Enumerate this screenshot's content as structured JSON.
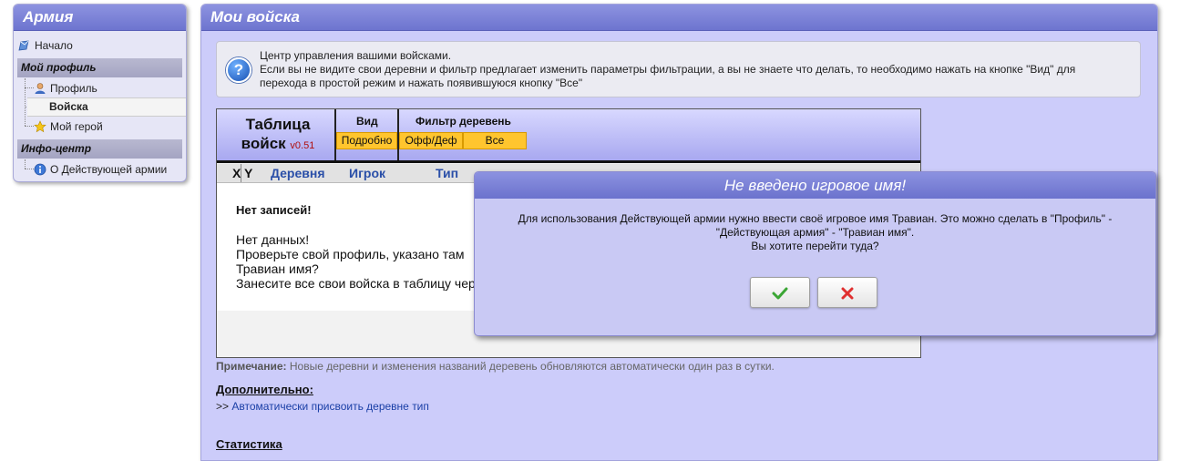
{
  "sidebar": {
    "title": "Армия",
    "items": {
      "home": "Начало",
      "profile_section": "Мой профиль",
      "profile": "Профиль",
      "troops": "Войска",
      "hero": "Мой герой",
      "info_section": "Инфо-центр",
      "about": "О Действующей армии"
    }
  },
  "main": {
    "title": "Мои войска",
    "info": {
      "line1": "Центр управления вашими войсками.",
      "line2": "Если вы не видите свои деревни и фильтр предлагает изменить параметры фильтрации, а вы не знаете что делать, то необходимо нажать на кнопке \"Вид\" для перехода в простой режим и нажать появившуюся кнопку \"Все\""
    },
    "table": {
      "title_line1": "Таблица",
      "title_line2": "войск",
      "version": "v0.51",
      "view_label": "Вид",
      "view_option": "Подробно",
      "filter_label": "Фильтр деревень",
      "filter_options": [
        "Офф/Деф",
        "Все"
      ],
      "columns": {
        "x": "X",
        "y": "Y",
        "village": "Деревня",
        "player": "Игрок",
        "type": "Тип"
      },
      "empty_title": "Нет записей!",
      "empty_lines": [
        "Нет данных!",
        "Проверьте свой профиль, указано там",
        "Травиан имя?",
        "Занесите все свои войска в таблицу чер"
      ]
    },
    "note_label": "Примечание:",
    "note_text": " Новые деревни и изменения названий деревень обновляются автоматически один раз в сутки.",
    "additional_heading": "Дополнительно:",
    "additional_prefix": ">> ",
    "additional_link": "Автоматически присвоить деревне тип",
    "stats_heading": "Статистика"
  },
  "dialog": {
    "title": "Не введено игровое имя!",
    "message_line1": "Для использования Действующей армии нужно ввести своё игровое имя Травиан. Это можно сделать в \"Профиль\" -",
    "message_line2": "\"Действующая армия\" - \"Травиан имя\".",
    "message_line3": "Вы хотите перейти туда?",
    "ok_icon": "check-icon",
    "cancel_icon": "cross-icon",
    "ok_color": "#3ba635",
    "cancel_color": "#e03030"
  },
  "colors": {
    "header_blue": "#7a80d8",
    "panel_bg": "#ccccfa",
    "option_orange": "#ffc52e",
    "link_blue": "#1a3fa6",
    "version_red": "#b01010"
  }
}
